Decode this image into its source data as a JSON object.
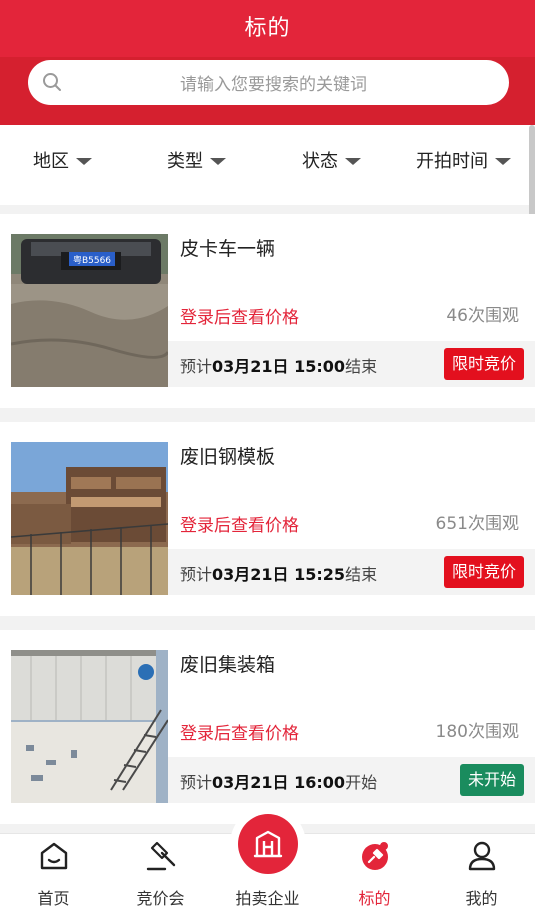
{
  "header": {
    "title": "标的"
  },
  "search": {
    "placeholder": "请输入您要搜索的关键词"
  },
  "filters": [
    "地区",
    "类型",
    "状态",
    "开拍时间"
  ],
  "items": [
    {
      "title": "皮卡车一辆",
      "price_text": "登录后查看价格",
      "views": "46次围观",
      "prefix": "预计",
      "time": "03月21日 15:00",
      "suffix": "结束",
      "badge": "限时竞价",
      "badge_color": "#e3101e"
    },
    {
      "title": "废旧钢模板",
      "price_text": "登录后查看价格",
      "views": "651次围观",
      "prefix": "预计",
      "time": "03月21日 15:25",
      "suffix": "结束",
      "badge": "限时竞价",
      "badge_color": "#e3101e"
    },
    {
      "title": "废旧集装箱",
      "price_text": "登录后查看价格",
      "views": "180次围观",
      "prefix": "预计",
      "time": "03月21日 16:00",
      "suffix": "开始",
      "badge": "未开始",
      "badge_color": "#1a8c5e"
    }
  ],
  "plate": "粤B5566",
  "tabbar": {
    "items": [
      {
        "label": "首页",
        "icon": "home-icon"
      },
      {
        "label": "竞价会",
        "icon": "gavel-icon"
      },
      {
        "label": "拍卖企业",
        "icon": "building-icon"
      },
      {
        "label": "标的",
        "icon": "lot-icon"
      },
      {
        "label": "我的",
        "icon": "user-icon"
      }
    ],
    "active_index": 3
  },
  "colors": {
    "brand": "#e3253a",
    "green": "#1a8c5e",
    "text_gray": "#8a8a8a"
  }
}
